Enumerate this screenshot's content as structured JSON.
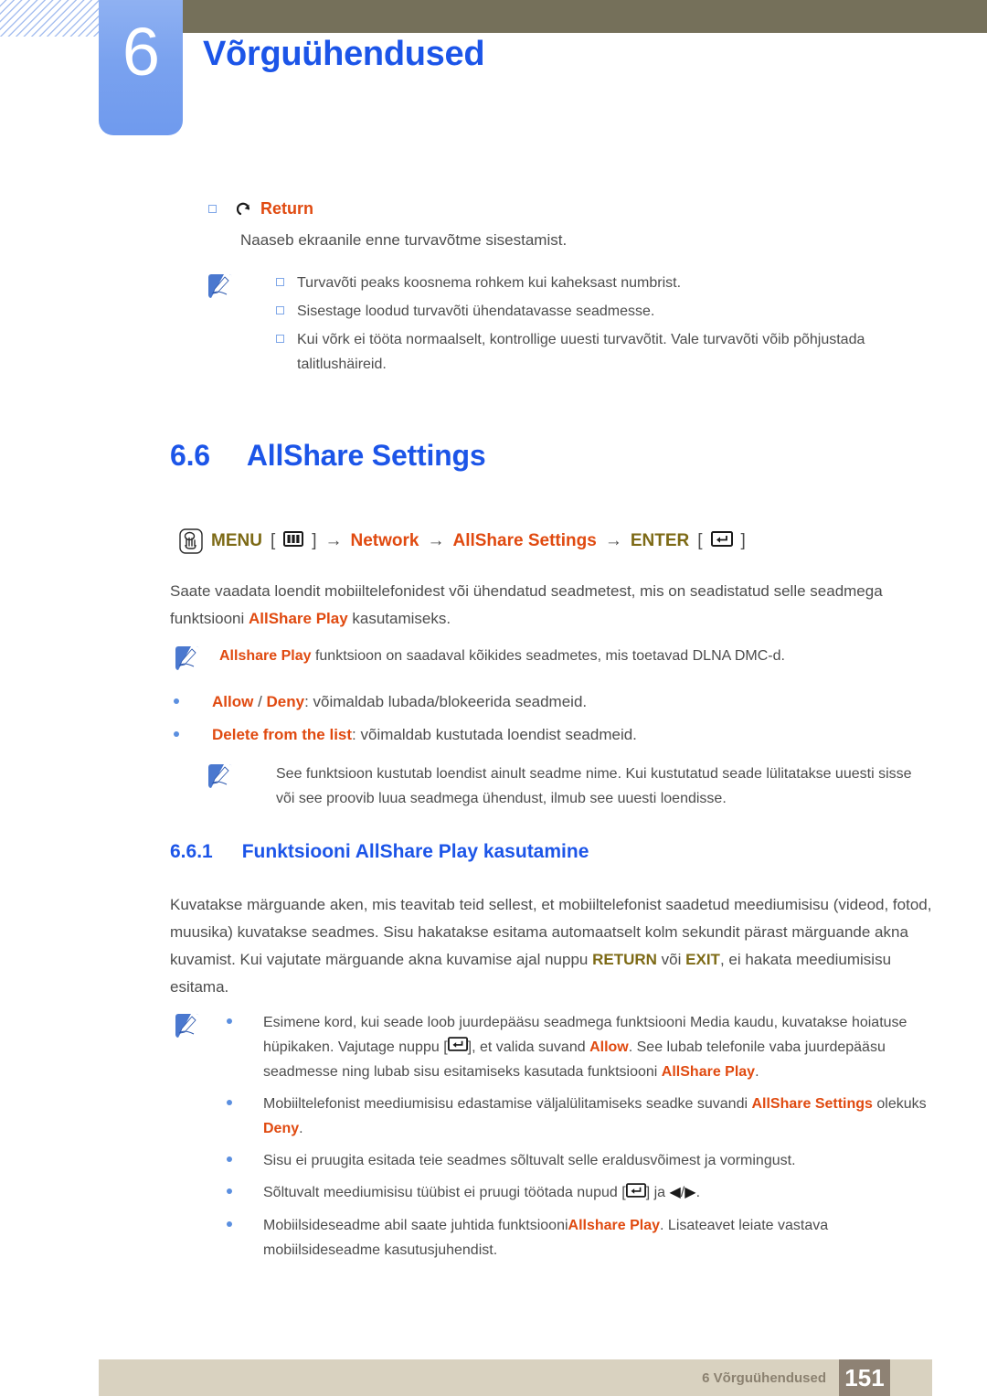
{
  "header": {
    "chapter_number": "6",
    "chapter_title": "Võrguühendused"
  },
  "return_section": {
    "icon": "return-arrow-icon",
    "label": "Return",
    "description": "Naaseb ekraanile enne turvavõtme sisestamist."
  },
  "note_one": {
    "icon": "note-pencil-icon",
    "items": [
      "Turvavõti peaks koosnema rohkem kui kaheksast numbrist.",
      "Sisestage loodud turvavõti ühendatavasse seadmesse.",
      "Kui võrk ei tööta normaalselt, kontrollige uuesti turvavõtit. Vale turvavõti võib põhjustada talitlushäireid."
    ]
  },
  "section": {
    "number": "6.6",
    "title": "AllShare Settings"
  },
  "menu_path": {
    "icon": "hand-press-icon",
    "menu_label": "MENU",
    "menu_key_icon": "menu-key-icon",
    "arrow": "→",
    "step_one": "Network",
    "step_two": "AllShare Settings",
    "enter_label": "ENTER",
    "enter_key_icon": "enter-key-icon",
    "bracket_open": "[",
    "bracket_close": "]"
  },
  "intro_paragraph": {
    "part1": "Saate vaadata loendit mobiiltelefonidest või ühendatud seadmetest, mis on seadistatud selle seadmega funktsiooni ",
    "highlight": "AllShare Play",
    "part2": " kasutamiseks."
  },
  "note_two": {
    "icon": "note-pencil-icon",
    "highlight": "Allshare Play",
    "text": " funktsioon on saadaval kõikides seadmetes, mis toetavad DLNA DMC-d."
  },
  "option_bullets": [
    {
      "term_a": "Allow",
      "separator": " / ",
      "term_b": "Deny",
      "description": ": võimaldab lubada/blokeerida seadmeid."
    },
    {
      "term_a": "Delete from the list",
      "separator": "",
      "term_b": "",
      "description": ": võimaldab kustutada loendist seadmeid."
    }
  ],
  "note_three": {
    "icon": "note-pencil-icon",
    "text": "See funktsioon kustutab loendist ainult seadme nime. Kui kustutatud seade lülitatakse uuesti sisse või see proovib luua seadmega ühendust, ilmub see uuesti loendisse."
  },
  "subsection": {
    "number": "6.6.1",
    "title": "Funktsiooni AllShare Play kasutamine"
  },
  "main_paragraph": {
    "part1": "Kuvatakse märguande aken, mis teavitab teid sellest, et mobiiltelefonist saadetud meediumisisu (videod, fotod, muusika) kuvatakse seadmes. Sisu hakatakse esitama automaatselt kolm sekundit pärast märguande akna kuvamist. Kui vajutate märguande akna kuvamise ajal nuppu ",
    "highlight1": "RETURN",
    "part2": " või ",
    "highlight2": "EXIT",
    "part3": ", ei hakata meediumisisu esitama."
  },
  "note_four": {
    "icon": "note-pencil-icon",
    "bullets": [
      {
        "text_a": "Esimene kord, kui seade loob juurdepääsu seadmega funktsiooni Media kaudu, kuvatakse hoiatuse hüpikaken. Vajutage nuppu [",
        "key_icon": "enter-key-icon",
        "text_b": "], et valida suvand ",
        "hl_a": "Allow",
        "text_c": ". See lubab telefonile vaba juurdepääsu seadmesse ning lubab sisu esitamiseks kasutada funktsiooni ",
        "hl_b": "AllShare Play",
        "text_d": "."
      },
      {
        "text_a": "Mobiiltelefonist meediumisisu edastamise väljalülitamiseks seadke suvandi ",
        "hl_a": "AllShare Settings",
        "text_b": " olekuks ",
        "hl_b": "Deny",
        "text_c": "."
      },
      {
        "text_a": "Sisu ei pruugita esitada teie seadmes sõltuvalt selle eraldusvõimest ja vormingust."
      },
      {
        "text_a": "Sõltuvalt meediumisisu tüübist ei pruugi töötada nupud [",
        "key_icon": "enter-key-icon",
        "text_b": "] ja ",
        "left_arrow": "◀",
        "slash": "/",
        "right_arrow": "▶",
        "text_c": "."
      },
      {
        "text_a": "Mobiilsideseadme abil saate juhtida funktsiooni",
        "hl_a": "Allshare Play",
        "text_b": ". Lisateavet leiate vastava mobiilsideseadme kasutusjuhendist."
      }
    ]
  },
  "footer": {
    "text": "6 Võrguühendused",
    "page": "151"
  },
  "colors": {
    "heading_blue": "#1c55e8",
    "orange": "#e04a10",
    "olive": "#7d6a16",
    "header_bar": "#75705a",
    "tab_blue": "#7aa2ef",
    "footer_bar": "#d9d2c0",
    "page_box": "#8e8274",
    "body_text": "#4d4d4d"
  }
}
